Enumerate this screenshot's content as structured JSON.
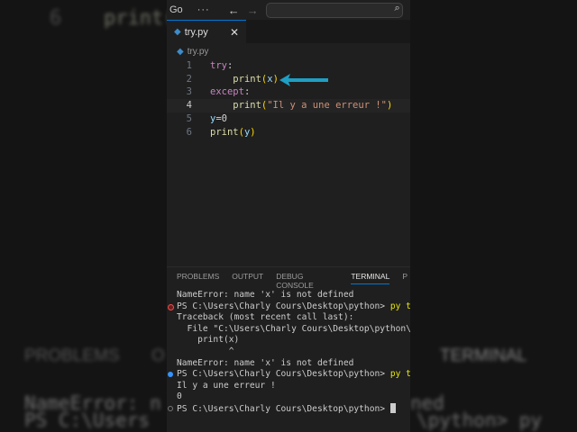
{
  "background": {
    "line_no": "6",
    "code": "print(",
    "problems": "PROBLEMS",
    "output_short": "O",
    "terminal": "TERMINAL",
    "name_err": "NameError: n",
    "ned": "ned",
    "ps": "PS C:\\Users",
    "python_py": "\\python> py"
  },
  "titlebar": {
    "menu": "Go",
    "more": "···",
    "back": "←",
    "forward": "→",
    "search_icon": "⌕"
  },
  "tab": {
    "label": "try.py",
    "close": "✕"
  },
  "breadcrumb": "try.py",
  "code": [
    {
      "n": "1",
      "parts": [
        [
          "kw",
          "try"
        ],
        [
          "t",
          ":"
        ]
      ]
    },
    {
      "n": "2",
      "parts": [
        [
          "t",
          "    "
        ],
        [
          "fn",
          "print"
        ],
        [
          "p",
          "("
        ],
        [
          "v",
          "x"
        ],
        [
          "p",
          ")"
        ]
      ]
    },
    {
      "n": "3",
      "parts": [
        [
          "kw",
          "except"
        ],
        [
          "t",
          ":"
        ]
      ]
    },
    {
      "n": "4",
      "parts": [
        [
          "t",
          "    "
        ],
        [
          "fn",
          "print"
        ],
        [
          "p",
          "("
        ],
        [
          "s",
          "\"Il y a une erreur !\""
        ],
        [
          "p",
          ")"
        ]
      ]
    },
    {
      "n": "5",
      "parts": [
        [
          "v",
          "y"
        ],
        [
          "t",
          "=0"
        ]
      ]
    },
    {
      "n": "6",
      "parts": [
        [
          "fn",
          "print"
        ],
        [
          "p",
          "("
        ],
        [
          "v",
          "y"
        ],
        [
          "p",
          ")"
        ]
      ]
    }
  ],
  "panel_tabs": [
    "PROBLEMS",
    "OUTPUT",
    "DEBUG CONSOLE",
    "TERMINAL",
    "P"
  ],
  "terminal": {
    "l1": "NameError: name 'x' is not defined",
    "l2": "PS C:\\Users\\Charly Cours\\Desktop\\python> ",
    "l2b": "py t",
    "l3": "Traceback (most recent call last):",
    "l4": "  File \"C:\\Users\\Charly Cours\\Desktop\\python\\",
    "l5": "    print(x)",
    "l6": "          ^",
    "l7": "NameError: name 'x' is not defined",
    "l8": "PS C:\\Users\\Charly Cours\\Desktop\\python> ",
    "l8b": "py t",
    "l9": "Il y a une erreur !",
    "l10": "0",
    "l11": "PS C:\\Users\\Charly Cours\\Desktop\\python> "
  },
  "colors": {
    "accent": "#0078d4",
    "arrow": "#1e9fc4",
    "error_dot": "#f14c4c",
    "ok_dot": "#3794ff"
  }
}
